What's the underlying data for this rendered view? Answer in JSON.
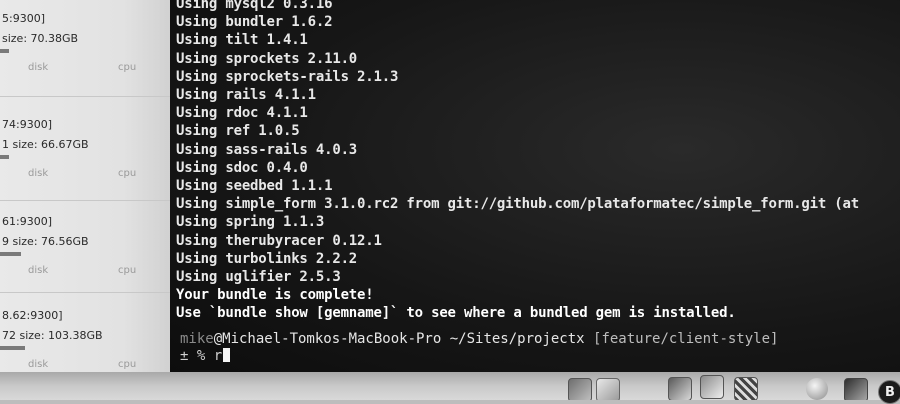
{
  "servers": [
    {
      "host": "5:9300]",
      "size": "size: 70.38GB",
      "disk_label": "disk",
      "cpu_label": "cpu",
      "disk_fill": 0.05
    },
    {
      "host": "74:9300]",
      "size": "1  size: 66.67GB",
      "disk_label": "disk",
      "cpu_label": "cpu",
      "disk_fill": 0.05
    },
    {
      "host": "61:9300]",
      "size": "9  size: 76.56GB",
      "disk_label": "disk",
      "cpu_label": "cpu",
      "disk_fill": 0.12
    },
    {
      "host": "8.62:9300]",
      "size": "72  size: 103.38GB",
      "disk_label": "disk",
      "cpu_label": "cpu",
      "disk_fill": 0.14
    }
  ],
  "terminal": {
    "output_lines": [
      "Using mysql2 0.3.16",
      "Using bundler 1.6.2",
      "Using tilt 1.4.1",
      "Using sprockets 2.11.0",
      "Using sprockets-rails 2.1.3",
      "Using rails 4.1.1",
      "Using rdoc 4.1.1",
      "Using ref 1.0.5",
      "Using sass-rails 4.0.3",
      "Using sdoc 0.4.0",
      "Using seedbed 1.1.1",
      "Using simple_form 3.1.0.rc2 from git://github.com/plataformatec/simple_form.git (at",
      "Using spring 1.1.3",
      "Using therubyracer 0.12.1",
      "Using turbolinks 2.2.2",
      "Using uglifier 2.5.3",
      "Your bundle is complete!",
      "Use `bundle show [gemname]` to see where a bundled gem is installed."
    ],
    "prompt": {
      "user": "mike",
      "host_path": "@Michael-Tomkos-MacBook-Pro ~/Sites/projectx",
      "branch": " [feature/client-style]"
    },
    "input": {
      "prefix": "± % ",
      "typed": "r"
    }
  },
  "dock": {
    "user_badge": "B"
  }
}
